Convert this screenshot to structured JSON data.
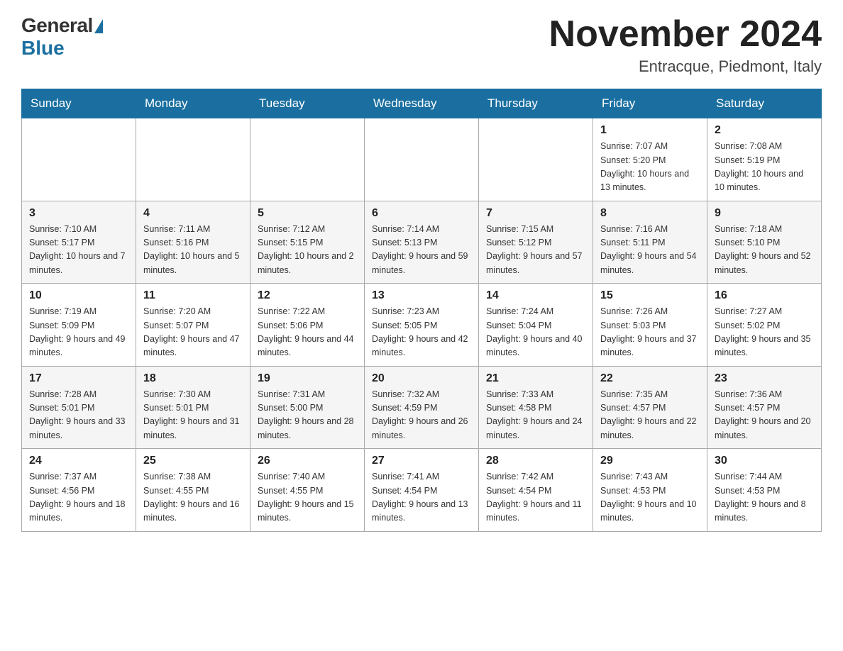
{
  "header": {
    "logo": {
      "general": "General",
      "blue": "Blue"
    },
    "title": "November 2024",
    "location": "Entracque, Piedmont, Italy"
  },
  "columns": [
    "Sunday",
    "Monday",
    "Tuesday",
    "Wednesday",
    "Thursday",
    "Friday",
    "Saturday"
  ],
  "weeks": [
    {
      "days": [
        {
          "number": "",
          "info": ""
        },
        {
          "number": "",
          "info": ""
        },
        {
          "number": "",
          "info": ""
        },
        {
          "number": "",
          "info": ""
        },
        {
          "number": "",
          "info": ""
        },
        {
          "number": "1",
          "info": "Sunrise: 7:07 AM\nSunset: 5:20 PM\nDaylight: 10 hours and 13 minutes."
        },
        {
          "number": "2",
          "info": "Sunrise: 7:08 AM\nSunset: 5:19 PM\nDaylight: 10 hours and 10 minutes."
        }
      ]
    },
    {
      "days": [
        {
          "number": "3",
          "info": "Sunrise: 7:10 AM\nSunset: 5:17 PM\nDaylight: 10 hours and 7 minutes."
        },
        {
          "number": "4",
          "info": "Sunrise: 7:11 AM\nSunset: 5:16 PM\nDaylight: 10 hours and 5 minutes."
        },
        {
          "number": "5",
          "info": "Sunrise: 7:12 AM\nSunset: 5:15 PM\nDaylight: 10 hours and 2 minutes."
        },
        {
          "number": "6",
          "info": "Sunrise: 7:14 AM\nSunset: 5:13 PM\nDaylight: 9 hours and 59 minutes."
        },
        {
          "number": "7",
          "info": "Sunrise: 7:15 AM\nSunset: 5:12 PM\nDaylight: 9 hours and 57 minutes."
        },
        {
          "number": "8",
          "info": "Sunrise: 7:16 AM\nSunset: 5:11 PM\nDaylight: 9 hours and 54 minutes."
        },
        {
          "number": "9",
          "info": "Sunrise: 7:18 AM\nSunset: 5:10 PM\nDaylight: 9 hours and 52 minutes."
        }
      ]
    },
    {
      "days": [
        {
          "number": "10",
          "info": "Sunrise: 7:19 AM\nSunset: 5:09 PM\nDaylight: 9 hours and 49 minutes."
        },
        {
          "number": "11",
          "info": "Sunrise: 7:20 AM\nSunset: 5:07 PM\nDaylight: 9 hours and 47 minutes."
        },
        {
          "number": "12",
          "info": "Sunrise: 7:22 AM\nSunset: 5:06 PM\nDaylight: 9 hours and 44 minutes."
        },
        {
          "number": "13",
          "info": "Sunrise: 7:23 AM\nSunset: 5:05 PM\nDaylight: 9 hours and 42 minutes."
        },
        {
          "number": "14",
          "info": "Sunrise: 7:24 AM\nSunset: 5:04 PM\nDaylight: 9 hours and 40 minutes."
        },
        {
          "number": "15",
          "info": "Sunrise: 7:26 AM\nSunset: 5:03 PM\nDaylight: 9 hours and 37 minutes."
        },
        {
          "number": "16",
          "info": "Sunrise: 7:27 AM\nSunset: 5:02 PM\nDaylight: 9 hours and 35 minutes."
        }
      ]
    },
    {
      "days": [
        {
          "number": "17",
          "info": "Sunrise: 7:28 AM\nSunset: 5:01 PM\nDaylight: 9 hours and 33 minutes."
        },
        {
          "number": "18",
          "info": "Sunrise: 7:30 AM\nSunset: 5:01 PM\nDaylight: 9 hours and 31 minutes."
        },
        {
          "number": "19",
          "info": "Sunrise: 7:31 AM\nSunset: 5:00 PM\nDaylight: 9 hours and 28 minutes."
        },
        {
          "number": "20",
          "info": "Sunrise: 7:32 AM\nSunset: 4:59 PM\nDaylight: 9 hours and 26 minutes."
        },
        {
          "number": "21",
          "info": "Sunrise: 7:33 AM\nSunset: 4:58 PM\nDaylight: 9 hours and 24 minutes."
        },
        {
          "number": "22",
          "info": "Sunrise: 7:35 AM\nSunset: 4:57 PM\nDaylight: 9 hours and 22 minutes."
        },
        {
          "number": "23",
          "info": "Sunrise: 7:36 AM\nSunset: 4:57 PM\nDaylight: 9 hours and 20 minutes."
        }
      ]
    },
    {
      "days": [
        {
          "number": "24",
          "info": "Sunrise: 7:37 AM\nSunset: 4:56 PM\nDaylight: 9 hours and 18 minutes."
        },
        {
          "number": "25",
          "info": "Sunrise: 7:38 AM\nSunset: 4:55 PM\nDaylight: 9 hours and 16 minutes."
        },
        {
          "number": "26",
          "info": "Sunrise: 7:40 AM\nSunset: 4:55 PM\nDaylight: 9 hours and 15 minutes."
        },
        {
          "number": "27",
          "info": "Sunrise: 7:41 AM\nSunset: 4:54 PM\nDaylight: 9 hours and 13 minutes."
        },
        {
          "number": "28",
          "info": "Sunrise: 7:42 AM\nSunset: 4:54 PM\nDaylight: 9 hours and 11 minutes."
        },
        {
          "number": "29",
          "info": "Sunrise: 7:43 AM\nSunset: 4:53 PM\nDaylight: 9 hours and 10 minutes."
        },
        {
          "number": "30",
          "info": "Sunrise: 7:44 AM\nSunset: 4:53 PM\nDaylight: 9 hours and 8 minutes."
        }
      ]
    }
  ]
}
